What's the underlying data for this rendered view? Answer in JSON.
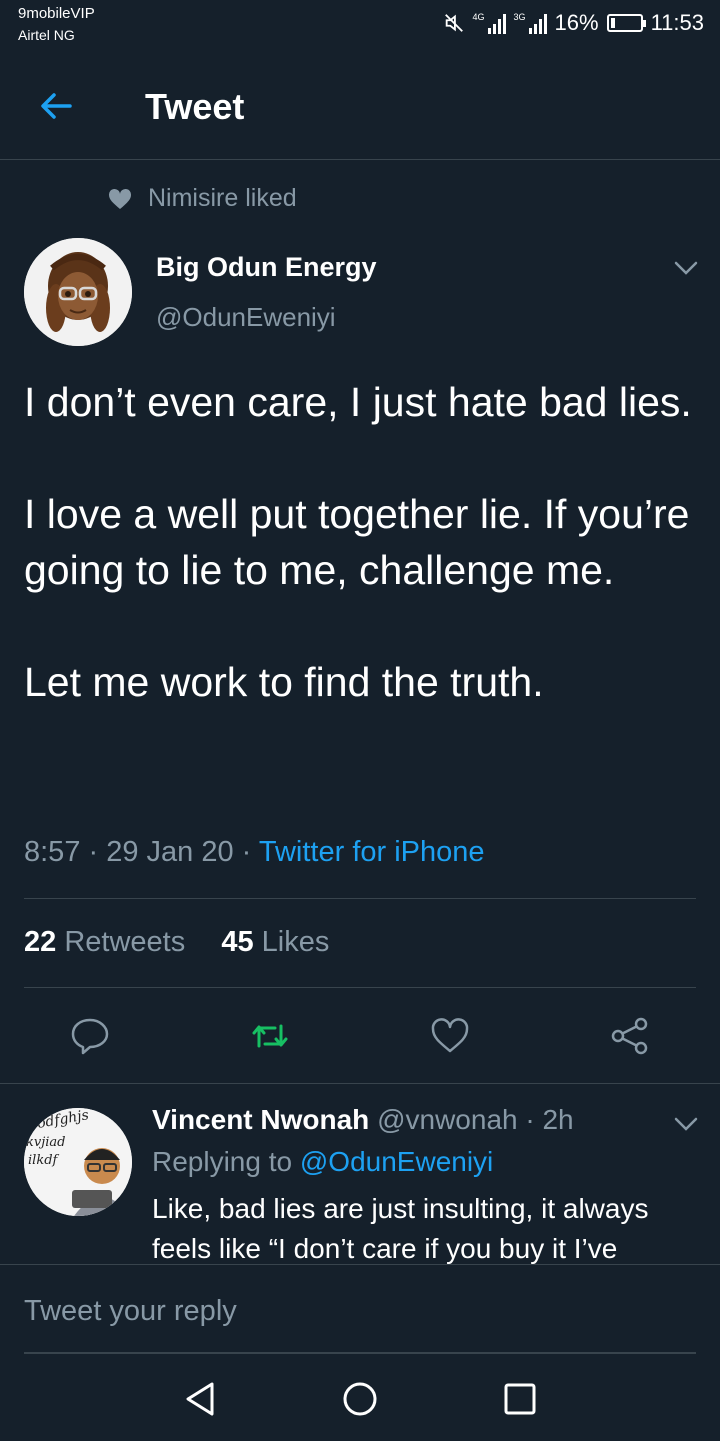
{
  "status_bar": {
    "carrier_primary": "9mobileVIP",
    "carrier_secondary": "Airtel NG",
    "signal1_label": "4G",
    "signal2_label": "3G",
    "battery": "16%",
    "battery_level": 0.16,
    "time": "11:53"
  },
  "header": {
    "title": "Tweet"
  },
  "tweet": {
    "social_context": "Nimisire liked",
    "author_name": "Big Odun Energy",
    "author_handle": "@OdunEweniyi",
    "paragraphs": [
      "I don’t even care, I just hate bad lies.",
      "I love a well put together lie. If you’re going to lie to me, challenge me.",
      "Let me work to find the truth."
    ],
    "time": "8:57 · 29 Jan 20 · ",
    "source": "Twitter for iPhone",
    "retweet_count": "22",
    "retweet_label": " Retweets",
    "like_count": "45",
    "like_label": " Likes"
  },
  "reply": {
    "author_name": "Vincent Nwonah",
    "author_handle": " @vnwonah · 2h",
    "replying_prefix": "Replying to ",
    "replying_handle": "@OdunEweniyi",
    "text": "Like, bad lies are just insulting, it always feels like “I don’t care if you buy it I’ve",
    "avatar_scribble": "odfghjs kvjiad ilkdf"
  },
  "compose": {
    "placeholder": "Tweet your reply"
  },
  "colors": {
    "background": "#15202b",
    "secondary_text": "#8899a6",
    "accent": "#1da1f2",
    "retweet_green": "#17bf63",
    "divider": "#38444d"
  },
  "icons": [
    "back-arrow-icon",
    "heart-icon",
    "chevron-down-icon",
    "reply-icon",
    "retweet-icon",
    "like-icon",
    "share-icon",
    "nav-back-icon",
    "nav-home-icon",
    "nav-recents-icon"
  ]
}
